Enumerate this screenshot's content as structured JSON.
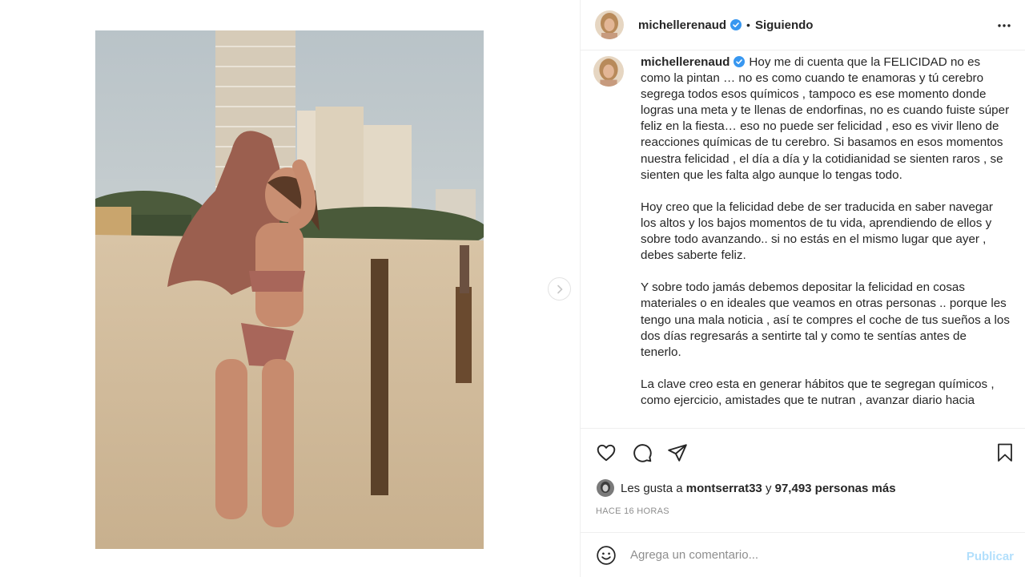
{
  "post": {
    "username": "michellerenaud",
    "follow_status": "Siguiendo",
    "separator": "•",
    "caption_paragraphs": [
      "Hoy me di cuenta que la FELICIDAD no es como la pintan … no es como cuando te enamoras y tú cerebro segrega todos esos químicos , tampoco es ese momento donde logras una meta y te llenas de endorfinas, no es cuando fuiste súper feliz en la fiesta… eso no puede ser felicidad , eso es vivir lleno de reacciones químicas de tu cerebro. Si basamos en esos momentos nuestra felicidad , el día a día y la cotidianidad se sienten raros , se sienten que les falta algo aunque lo tengas todo.",
      "Hoy creo que la felicidad debe de ser traducida en saber navegar los altos y los bajos momentos de tu vida, aprendiendo de ellos y sobre todo avanzando.. si no estás en el mismo lugar que ayer , debes saberte feliz.",
      "Y sobre todo jamás debemos depositar la felicidad en cosas materiales o en ideales que veamos en otras personas .. porque les tengo una mala noticia , así te compres el coche de tus sueños a los dos días regresarás a sentirte tal y como te sentías antes de tenerlo.",
      "La clave creo esta en generar hábitos que te segregan químicos , como ejercicio, amistades que te nutran , avanzar diario hacia"
    ],
    "likes": {
      "prefix": "Les gusta a",
      "user": "montserrat33",
      "connector": "y",
      "count_text": "97,493 personas más"
    },
    "time_ago": "HACE 16 HORAS"
  },
  "comment": {
    "placeholder": "Agrega un comentario...",
    "publish_label": "Publicar"
  },
  "icons": {
    "verified": "verified-badge-icon",
    "more": "more-options-icon",
    "like": "heart-icon",
    "comment": "comment-bubble-icon",
    "share": "paper-plane-icon",
    "save": "bookmark-icon",
    "emoji": "emoji-icon",
    "next": "chevron-right-icon"
  },
  "colors": {
    "text": "#262626",
    "muted": "#8e8e8e",
    "verified_blue": "#3897f0",
    "publish_disabled": "#b2dffc",
    "divider": "#efefef"
  }
}
